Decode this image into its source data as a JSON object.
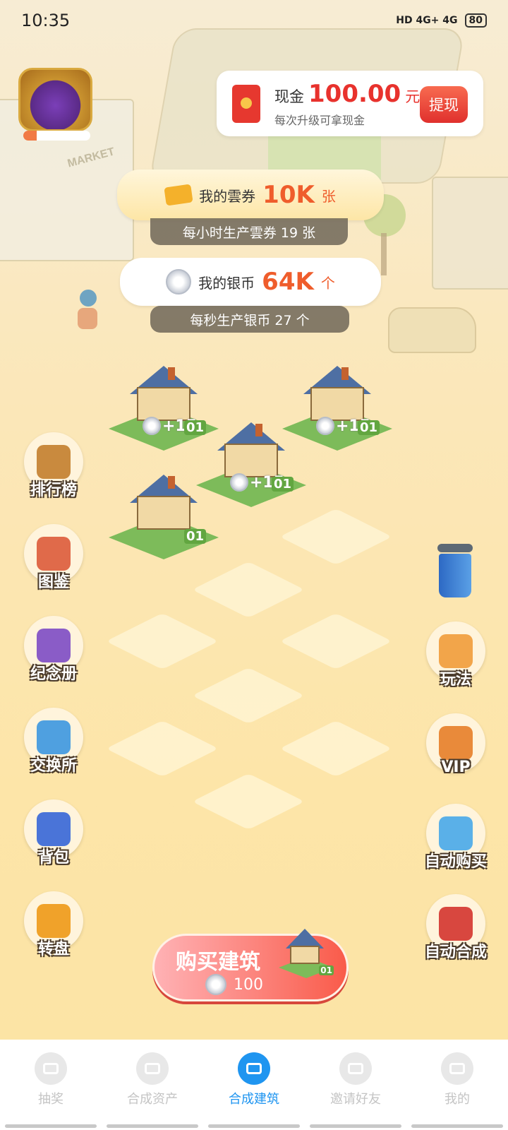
{
  "status_bar": {
    "time": "10:35",
    "network": "HD 4G+ 4G",
    "battery": "80"
  },
  "chest": {
    "progress": 0.2
  },
  "cash": {
    "label": "现金",
    "amount": "100.00",
    "unit": "元",
    "subtitle": "每次升级可拿现金",
    "withdraw_label": "提现"
  },
  "coupon": {
    "label": "我的雲券",
    "value": "10K",
    "unit": "张",
    "rate_text": "每小时生产雲券 19 张"
  },
  "silver": {
    "label": "我的银币",
    "value": "64K",
    "unit": "个",
    "rate_text": "每秒生产银币 27 个"
  },
  "scene": {
    "market_sign": "MARKET"
  },
  "houses": [
    {
      "level": "01",
      "earn": "+15"
    },
    {
      "level": "01",
      "earn": "+15"
    },
    {
      "level": "01",
      "earn": "+15"
    },
    {
      "level": "01",
      "earn": ""
    }
  ],
  "left_menu": [
    {
      "label": "排行榜",
      "icon": "trophy-icon",
      "color": "#c98a3e"
    },
    {
      "label": "图鉴",
      "icon": "magnifier-icon",
      "color": "#e06a4a"
    },
    {
      "label": "纪念册",
      "icon": "album-icon",
      "color": "#8a5cc7"
    },
    {
      "label": "交换所",
      "icon": "shop-icon",
      "color": "#4fa0e0"
    },
    {
      "label": "背包",
      "icon": "bag-icon",
      "color": "#4a74d8"
    },
    {
      "label": "转盘",
      "icon": "wheel-icon",
      "color": "#f0a22a"
    }
  ],
  "right_menu": [
    {
      "label": "玩法",
      "icon": "cube-icon",
      "color": "#f2a54a"
    },
    {
      "label": "VIP",
      "icon": "crown-icon",
      "color": "#e98a3a"
    },
    {
      "label": "自动购买",
      "icon": "gift-icon",
      "color": "#5ab0e8"
    },
    {
      "label": "自动合成",
      "icon": "magnet-icon",
      "color": "#d8473f"
    }
  ],
  "buy_button": {
    "title": "购买建筑",
    "cost": "100",
    "house_level": "01"
  },
  "bottom_nav": [
    {
      "label": "抽奖",
      "active": false
    },
    {
      "label": "合成资产",
      "active": false
    },
    {
      "label": "合成建筑",
      "active": true
    },
    {
      "label": "邀请好友",
      "active": false
    },
    {
      "label": "我的",
      "active": false
    }
  ]
}
